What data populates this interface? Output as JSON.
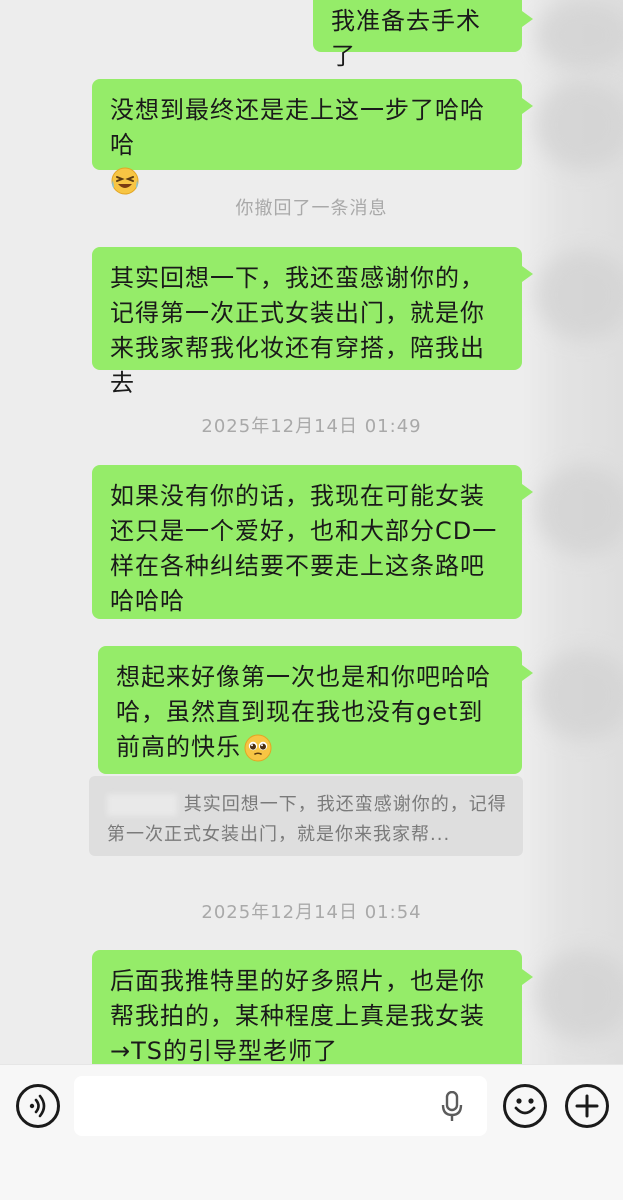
{
  "messages": [
    {
      "text": "我准备去手术了"
    },
    {
      "text": "没想到最终还是走上这一步了哈哈哈",
      "emoji": "laughing-sweat-emoji"
    },
    {
      "text": "其实回想一下，我还蛮感谢你的，记得第一次正式女装出门，就是你来我家帮我化妆还有穿搭，陪我出去"
    },
    {
      "text": "如果没有你的话，我现在可能女装还只是一个爱好，也和大部分CD一样在各种纠结要不要走上这条路吧哈哈哈"
    },
    {
      "text": "想起来好像第一次也是和你吧哈哈哈，虽然直到现在我也没有get到前高的快乐",
      "emoji": "pleading-face-emoji"
    },
    {
      "text": "后面我推特里的好多照片，也是你帮我拍的，某种程度上真是我女装→TS的引导型老师了"
    }
  ],
  "system": {
    "recalled": "你撤回了一条消息",
    "time1": "2025年12月14日 01:49",
    "time2": "2025年12月14日 01:54"
  },
  "quote": {
    "text": "其实回想一下，我还蛮感谢你的，记得第一次正式女装出门，就是你来我家帮..."
  },
  "input": {
    "value": "",
    "voice_icon": "voice-icon",
    "mic_icon": "microphone-icon",
    "emoji_icon": "emoji-icon",
    "plus_icon": "plus-icon"
  },
  "colors": {
    "bubble": "#95ec69",
    "background": "#ededed",
    "system_text": "#a9a9a9"
  }
}
